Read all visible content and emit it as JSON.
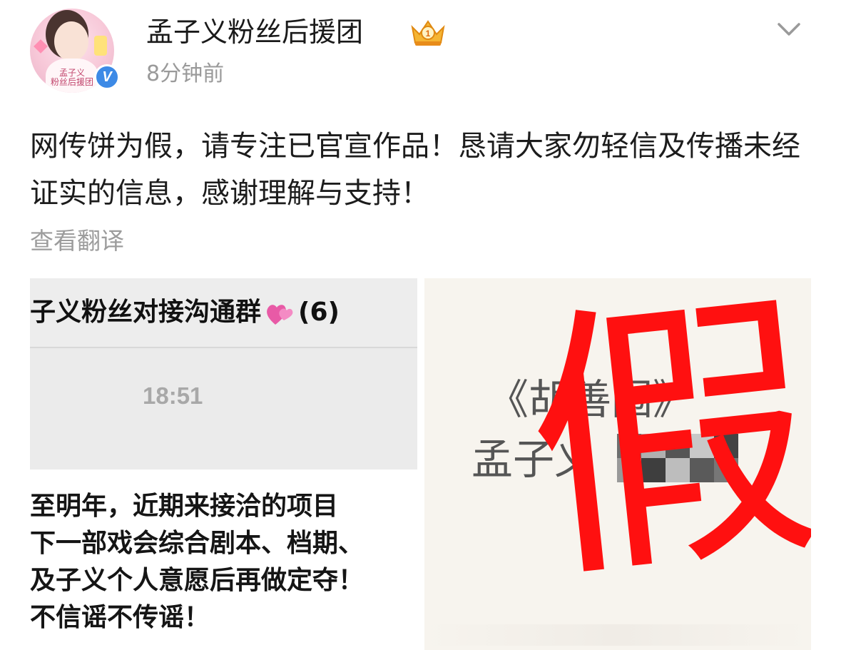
{
  "header": {
    "account_name": "孟子义粉丝后援团",
    "post_time": "8分钟前",
    "avatar_caption": "孟子义\n粉丝后援团",
    "verified_mark": "V"
  },
  "post": {
    "text": "网传饼为假，请专注已官宣作品！恳请大家勿轻信及传播未经证实的信息，感谢理解与支持！",
    "translate_label": "查看翻译"
  },
  "image_left": {
    "chat_title_prefix": "子义粉丝对接沟通群",
    "chat_title_count": "(6)",
    "chat_time": "18:51",
    "message_lines": [
      "至明年，近期来接洽的项目",
      "下一部戏会综合剧本、档期、",
      "及子义个人意愿后再做定夺！",
      "不信谣不传谣！"
    ]
  },
  "image_right": {
    "drama_title": "《胡善围》",
    "actor_name": "孟子义",
    "stamp_text": "假"
  },
  "colors": {
    "verified_blue": "#3d8ae6",
    "stamp_red": "#ff1010",
    "muted_gray": "#9a9a9a"
  }
}
